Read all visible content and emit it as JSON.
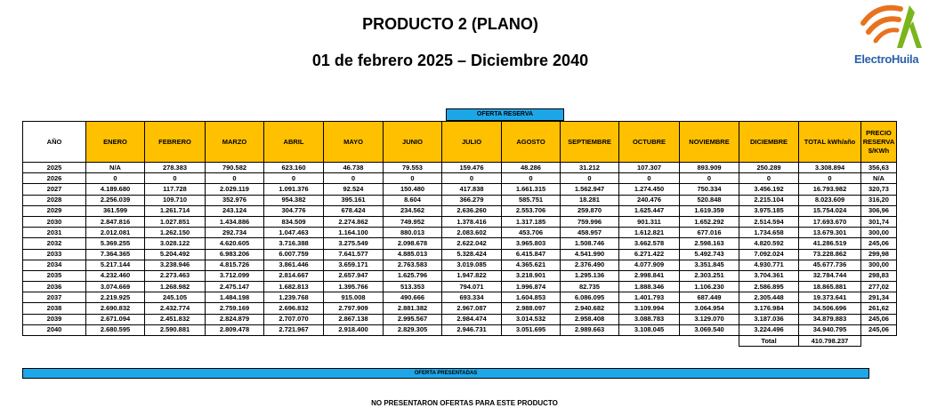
{
  "header": {
    "title": "PRODUCTO 2 (PLANO)",
    "subtitle": "01 de febrero 2025 – Diciembre 2040",
    "logo_text": "ElectroHuila"
  },
  "colors": {
    "header_fill": "#ffc000",
    "bar_fill": "#1ea7e8",
    "logo_orange": "#e8731e",
    "logo_green": "#7ab51d",
    "logo_blue": "#2a5fa8"
  },
  "labels": {
    "oferta_reserva": "OFERTA RESERVA",
    "oferta_presentadas": "OFERTA PRESENTADAS",
    "no_ofertas": "NO PRESENTARON OFERTAS PARA ESTE PRODUCTO",
    "total_label": "Total",
    "total_value": "410.798.237"
  },
  "table": {
    "columns": [
      "AÑO",
      "ENERO",
      "FEBRERO",
      "MARZO",
      "ABRIL",
      "MAYO",
      "JUNIO",
      "JULIO",
      "AGOSTO",
      "SEPTIEMBRE",
      "OCTUBRE",
      "NOVIEMBRE",
      "DICIEMBRE",
      "TOTAL kWh/año",
      "PRECIO RESERVA $/KWh"
    ],
    "rows": [
      [
        "2025",
        "N/A",
        "278.383",
        "790.582",
        "623.160",
        "46.738",
        "79.553",
        "159.476",
        "48.286",
        "31.212",
        "107.307",
        "893.909",
        "250.289",
        "3.308.894",
        "356,63"
      ],
      [
        "2026",
        "0",
        "0",
        "0",
        "0",
        "0",
        "0",
        "0",
        "0",
        "0",
        "0",
        "0",
        "0",
        "0",
        "N/A"
      ],
      [
        "2027",
        "4.189.680",
        "117.728",
        "2.029.119",
        "1.091.376",
        "92.524",
        "150.480",
        "417.838",
        "1.661.315",
        "1.562.947",
        "1.274.450",
        "750.334",
        "3.456.192",
        "16.793.982",
        "320,73"
      ],
      [
        "2028",
        "2.256.039",
        "109.710",
        "352.976",
        "954.382",
        "395.161",
        "8.604",
        "366.279",
        "585.751",
        "18.281",
        "240.476",
        "520.848",
        "2.215.104",
        "8.023.609",
        "316,20"
      ],
      [
        "2029",
        "361.599",
        "1.261.714",
        "243.124",
        "304.776",
        "678.424",
        "234.562",
        "2.636.260",
        "2.553.706",
        "259.870",
        "1.625.447",
        "1.619.359",
        "3.975.185",
        "15.754.024",
        "306,96"
      ],
      [
        "2030",
        "2.847.816",
        "1.027.851",
        "1.434.886",
        "834.509",
        "2.274.862",
        "749.952",
        "1.378.416",
        "1.317.185",
        "759.996",
        "901.311",
        "1.652.292",
        "2.514.594",
        "17.693.670",
        "301,74"
      ],
      [
        "2031",
        "2.012.081",
        "1.262.150",
        "292.734",
        "1.047.463",
        "1.164.100",
        "880.013",
        "2.083.602",
        "453.706",
        "458.957",
        "1.612.821",
        "677.016",
        "1.734.658",
        "13.679.301",
        "300,00"
      ],
      [
        "2032",
        "5.369.255",
        "3.028.122",
        "4.620.605",
        "3.716.388",
        "3.275.549",
        "2.098.678",
        "2.622.042",
        "3.965.803",
        "1.508.746",
        "3.662.578",
        "2.598.163",
        "4.820.592",
        "41.286.519",
        "245,06"
      ],
      [
        "2033",
        "7.364.365",
        "5.204.492",
        "6.983.206",
        "6.007.759",
        "7.641.577",
        "4.885.013",
        "5.328.424",
        "6.415.847",
        "4.541.990",
        "6.271.422",
        "5.492.743",
        "7.092.024",
        "73.228.862",
        "299,98"
      ],
      [
        "2034",
        "5.217.144",
        "3.238.946",
        "4.815.726",
        "3.861.446",
        "3.659.171",
        "2.763.583",
        "3.019.085",
        "4.365.621",
        "2.376.490",
        "4.077.909",
        "3.351.845",
        "4.930.771",
        "45.677.736",
        "300,00"
      ],
      [
        "2035",
        "4.232.460",
        "2.273.463",
        "3.712.099",
        "2.814.667",
        "2.657.947",
        "1.625.796",
        "1.947.822",
        "3.218.901",
        "1.295.136",
        "2.998.841",
        "2.303.251",
        "3.704.361",
        "32.784.744",
        "298,83"
      ],
      [
        "2036",
        "3.074.669",
        "1.268.982",
        "2.475.147",
        "1.682.813",
        "1.395.766",
        "513.353",
        "794.071",
        "1.996.874",
        "82.735",
        "1.888.346",
        "1.106.230",
        "2.586.895",
        "18.865.881",
        "277,02"
      ],
      [
        "2037",
        "2.219.925",
        "245.105",
        "1.484.198",
        "1.239.768",
        "915.008",
        "490.666",
        "693.334",
        "1.604.853",
        "6.086.095",
        "1.401.793",
        "687.449",
        "2.305.448",
        "19.373.641",
        "291,34"
      ],
      [
        "2038",
        "2.690.832",
        "2.432.774",
        "2.759.169",
        "2.696.832",
        "2.797.909",
        "2.881.382",
        "2.967.087",
        "2.988.097",
        "2.940.682",
        "3.109.994",
        "3.064.954",
        "3.176.984",
        "34.506.696",
        "261,62"
      ],
      [
        "2039",
        "2.671.094",
        "2.451.832",
        "2.824.879",
        "2.707.070",
        "2.867.138",
        "2.995.567",
        "2.984.474",
        "3.014.532",
        "2.958.408",
        "3.088.783",
        "3.129.070",
        "3.187.036",
        "34.879.883",
        "245,06"
      ],
      [
        "2040",
        "2.680.595",
        "2.590.881",
        "2.809.478",
        "2.721.967",
        "2.918.400",
        "2.829.305",
        "2.946.731",
        "3.051.695",
        "2.989.663",
        "3.108.045",
        "3.069.540",
        "3.224.496",
        "34.940.795",
        "245,06"
      ]
    ]
  }
}
